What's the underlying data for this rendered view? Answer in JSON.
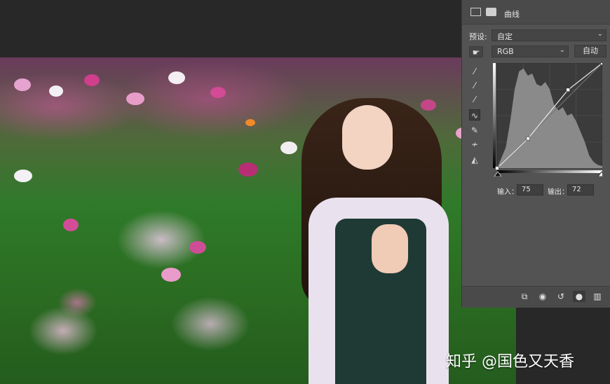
{
  "panel": {
    "title": "曲线",
    "preset_label": "预设:",
    "preset_value": "自定",
    "channel_value": "RGB",
    "auto_button": "自动",
    "input_label": "输入：",
    "input_value": "75",
    "output_label": "输出：",
    "output_value": "72"
  },
  "tools": [
    {
      "name": "target-adjust-icon"
    },
    {
      "name": "black-point-eyedropper-icon"
    },
    {
      "name": "gray-point-eyedropper-icon"
    },
    {
      "name": "white-point-eyedropper-icon"
    },
    {
      "name": "curve-point-icon"
    },
    {
      "name": "pencil-draw-icon"
    },
    {
      "name": "smooth-curve-icon"
    },
    {
      "name": "clipping-warning-icon"
    }
  ],
  "curve": {
    "points": [
      [
        0,
        0
      ],
      [
        75,
        72
      ],
      [
        172,
        190
      ],
      [
        255,
        255
      ]
    ]
  },
  "bottom_icons": [
    "clip-to-layer-icon",
    "view-previous-icon",
    "reset-icon",
    "visibility-icon",
    "trash-icon"
  ],
  "watermark": "知乎 @国色又天香"
}
